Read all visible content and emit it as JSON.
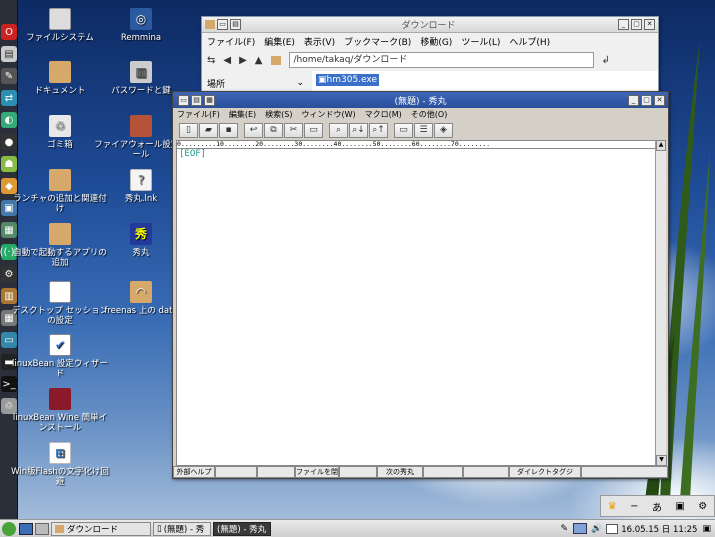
{
  "desktop_icons": [
    {
      "label": "ファイルシステム",
      "icon": "drive-icon"
    },
    {
      "label": "Remmina",
      "icon": "remmina-icon"
    },
    {
      "label": "ドキュメント",
      "icon": "folder-icon"
    },
    {
      "label": "パスワードと鍵",
      "icon": "keyring-icon"
    },
    {
      "label": "ゴミ箱",
      "icon": "trash-icon"
    },
    {
      "label": "ファイアウォール設定ツール",
      "icon": "firewall-icon"
    },
    {
      "label": "ランチャの追加と関連付け",
      "icon": "folder-icon"
    },
    {
      "label": "秀丸.lnk",
      "icon": "shortcut-icon"
    },
    {
      "label": "自動で起動するアプリの追加",
      "icon": "folder-icon"
    },
    {
      "label": "秀丸",
      "icon": "hidemaru-icon"
    },
    {
      "label": "デスクトップ セッションの設定",
      "icon": "session-icon"
    },
    {
      "label": "freenas 上の data",
      "icon": "network-folder-icon"
    },
    {
      "label": "linuxBean 設定ウィザード",
      "icon": "wizard-icon"
    },
    {
      "label": "linuxBean Wine 簡単インストール",
      "icon": "wine-icon"
    },
    {
      "label": "Win版Flashの文字化け回避",
      "icon": "windows-icon"
    }
  ],
  "file_manager": {
    "title": "ダウンロード",
    "menu": [
      "ファイル(F)",
      "編集(E)",
      "表示(V)",
      "ブックマーク(B)",
      "移動(G)",
      "ツール(L)",
      "ヘルプ(H)"
    ],
    "path": "/home/takaq/ダウンロード",
    "places_label": "場所",
    "file": "hm305.exe"
  },
  "editor": {
    "title": "(無題) - 秀丸",
    "menu": [
      "ファイル(F)",
      "編集(E)",
      "検索(S)",
      "ウィンドウ(W)",
      "マクロ(M)",
      "その他(O)"
    ],
    "ruler": "0.........10........20........30........40........50........60........70........",
    "eof": "[EOF]",
    "fkeys": [
      "外部ヘルプ",
      "",
      "",
      "ファイルを閉じ",
      "",
      "次の秀丸",
      "",
      "",
      "ダイレクトタグジ",
      ""
    ]
  },
  "taskbar": {
    "tasks": [
      "ダウンロード",
      "(無題) - 秀",
      "(無題) - 秀丸"
    ],
    "clock": "16.05.15 日 11:25"
  },
  "colors": {
    "dock_bg": "#2a2f3a",
    "titlebar_active": "#3a60b0",
    "eof": "#1a9a8a"
  }
}
